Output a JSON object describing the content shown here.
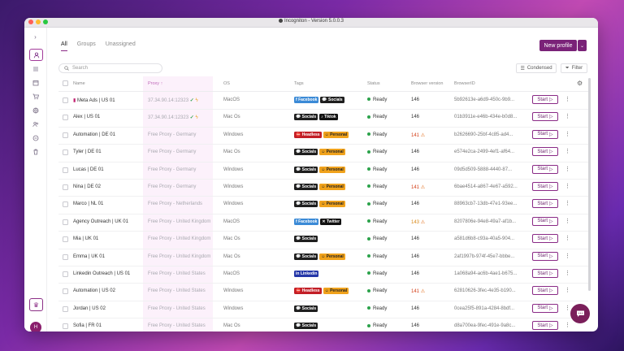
{
  "window": {
    "title": "Incogniton - Version 5.0.0.3"
  },
  "sidebar": {
    "icons": [
      "chevron-right-icon",
      "user-icon",
      "list-icon",
      "calendar-icon",
      "cart-icon",
      "globe-icon",
      "users-icon",
      "shield-icon",
      "trash-icon"
    ],
    "avatar_initial": "H"
  },
  "tabs": [
    "All",
    "Groups",
    "Unassigned"
  ],
  "toolbar": {
    "new_profile_label": "New profile",
    "search_placeholder": "Search",
    "condensed_label": "Condensed",
    "filter_label": "Filter"
  },
  "columns": {
    "name": "Name",
    "proxy": "Proxy",
    "os": "OS",
    "tags": "Tags",
    "status": "Status",
    "browser_version": "Browser version",
    "browser_id": "BrowserID"
  },
  "start_label": "Start",
  "rows": [
    {
      "name": "Meta Ads | US 01",
      "pinned": true,
      "proxy": "37.34.90.14:12323",
      "proxy_ok": true,
      "os": "MacOS",
      "tags": [
        "Facebook",
        "Socials"
      ],
      "status": "Ready",
      "version": "146",
      "version_warn": "",
      "browser_id": "5b92613e-a6d9-450c-9b9..."
    },
    {
      "name": "Alex | US 01",
      "pinned": false,
      "proxy": "37.34.90.14:12323",
      "proxy_ok": true,
      "os": "Mac Os",
      "tags": [
        "Socials",
        "Tiktok"
      ],
      "status": "Ready",
      "version": "146",
      "version_warn": "",
      "browser_id": "01b3911e-e46b-434e-b0d8..."
    },
    {
      "name": "Automation | DE 01",
      "pinned": false,
      "proxy": "Free Proxy - Germany",
      "proxy_ok": false,
      "os": "Windows",
      "tags": [
        "Headless",
        "Personal"
      ],
      "status": "Ready",
      "version": "141",
      "version_warn": "red",
      "browser_id": "b2626690-25bf-4c85-ad4..."
    },
    {
      "name": "Tyler | DE 01",
      "pinned": false,
      "proxy": "Free Proxy - Germany",
      "proxy_ok": false,
      "os": "Mac Os",
      "tags": [
        "Socials",
        "Personal"
      ],
      "status": "Ready",
      "version": "146",
      "version_warn": "",
      "browser_id": "e574e2ca-2499-4ef1-af64..."
    },
    {
      "name": "Lucas | DE 01",
      "pinned": false,
      "proxy": "Free Proxy - Germany",
      "proxy_ok": false,
      "os": "Windows",
      "tags": [
        "Socials",
        "Personal"
      ],
      "status": "Ready",
      "version": "146",
      "version_warn": "",
      "browser_id": "09d5d509-5888-4440-87..."
    },
    {
      "name": "Nina | DE 02",
      "pinned": false,
      "proxy": "Free Proxy - Germany",
      "proxy_ok": false,
      "os": "Windows",
      "tags": [
        "Socials",
        "Personal"
      ],
      "status": "Ready",
      "version": "141",
      "version_warn": "red",
      "browser_id": "6bae4514-a867-4e67-a592..."
    },
    {
      "name": "Marco | NL 01",
      "pinned": false,
      "proxy": "Free Proxy - Netherlands",
      "proxy_ok": false,
      "os": "Windows",
      "tags": [
        "Socials",
        "Personal"
      ],
      "status": "Ready",
      "version": "146",
      "version_warn": "",
      "browser_id": "88963cb7-13db-47e1-93ee..."
    },
    {
      "name": "Agency Outreach | UK 01",
      "pinned": false,
      "proxy": "Free Proxy - United Kingdom",
      "proxy_ok": false,
      "os": "MacOS",
      "tags": [
        "Facebook",
        "Twitter"
      ],
      "status": "Ready",
      "version": "143",
      "version_warn": "orange",
      "browser_id": "8207806e-94e8-49a7-af1b..."
    },
    {
      "name": "Mia | UK 01",
      "pinned": false,
      "proxy": "Free Proxy - United Kingdom",
      "proxy_ok": false,
      "os": "Mac Os",
      "tags": [
        "Socials"
      ],
      "status": "Ready",
      "version": "146",
      "version_warn": "",
      "browser_id": "a581d6b8-c93a-40a5-904..."
    },
    {
      "name": "Emma | UK 01",
      "pinned": false,
      "proxy": "Free Proxy - United Kingdom",
      "proxy_ok": false,
      "os": "Mac Os",
      "tags": [
        "Socials",
        "Personal"
      ],
      "status": "Ready",
      "version": "146",
      "version_warn": "",
      "browser_id": "2af1997b-974f-45e7-bbbe..."
    },
    {
      "name": "Linkedin Outreach | US 01",
      "pinned": false,
      "proxy": "Free Proxy - United States",
      "proxy_ok": false,
      "os": "MacOS",
      "tags": [
        "Linkedin"
      ],
      "status": "Ready",
      "version": "146",
      "version_warn": "",
      "browser_id": "1a068a94-ac6b-4ae1-b675..."
    },
    {
      "name": "Automation | US 02",
      "pinned": false,
      "proxy": "Free Proxy - United States",
      "proxy_ok": false,
      "os": "Windows",
      "tags": [
        "Headless",
        "Personal"
      ],
      "status": "Ready",
      "version": "141",
      "version_warn": "red",
      "browser_id": "62810626-3fec-4e35-b190..."
    },
    {
      "name": "Jordan | US 02",
      "pinned": false,
      "proxy": "Free Proxy - United States",
      "proxy_ok": false,
      "os": "Windows",
      "tags": [
        "Socials"
      ],
      "status": "Ready",
      "version": "146",
      "version_warn": "",
      "browser_id": "0cea25f5-891a-4284-8bdf..."
    },
    {
      "name": "Sofia | FR 01",
      "pinned": false,
      "proxy": "Free Proxy - United States",
      "proxy_ok": false,
      "os": "Mac Os",
      "tags": [
        "Socials"
      ],
      "status": "Ready",
      "version": "146",
      "version_warn": "",
      "browser_id": "d8a700ea-9fec-491e-9a8c..."
    }
  ]
}
